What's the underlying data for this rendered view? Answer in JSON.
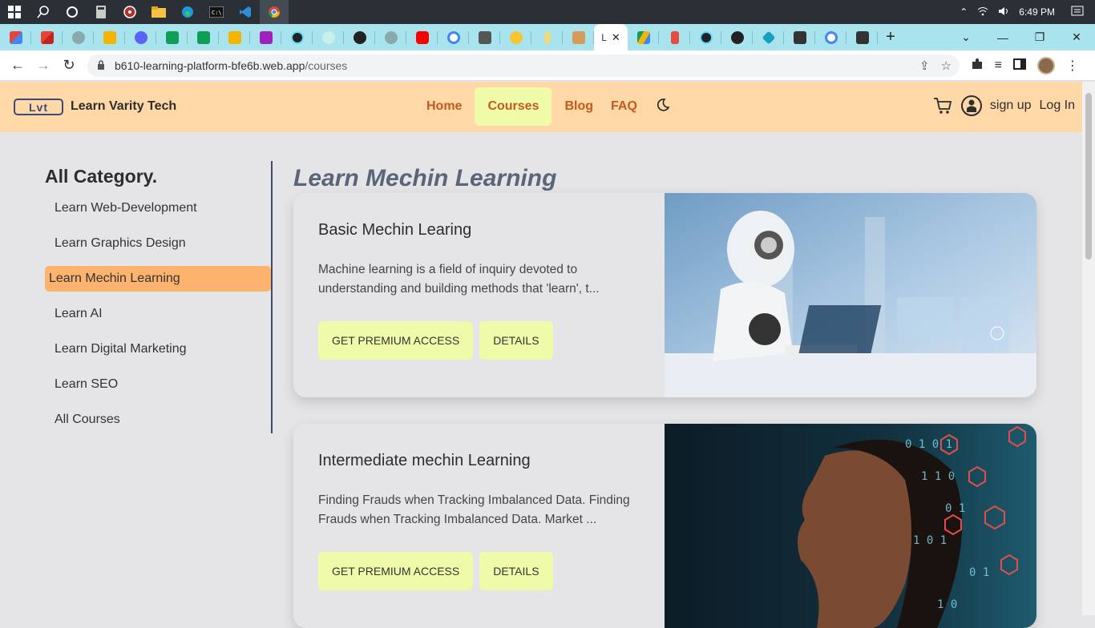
{
  "taskbar": {
    "time": "6:49 PM",
    "icons": [
      "windows-start",
      "search",
      "cortana",
      "calculator",
      "media",
      "file-explorer",
      "edge",
      "terminal",
      "vscode",
      "chrome"
    ]
  },
  "browser": {
    "url_host": "b610-learning-platform-bfe6b.web.app",
    "url_path": "/courses",
    "active_tab_label": "L",
    "tab_close": "✕",
    "new_tab": "+"
  },
  "site": {
    "logo_text": "Lvt",
    "name": "Learn Varity Tech",
    "nav": [
      {
        "label": "Home"
      },
      {
        "label": "Courses"
      },
      {
        "label": "Blog"
      },
      {
        "label": "FAQ"
      }
    ],
    "signup_label": "sign up",
    "login_label": "Log In"
  },
  "sidebar": {
    "title": "All Category.",
    "items": [
      {
        "label": "Learn Web-Development"
      },
      {
        "label": "Learn Graphics Design"
      },
      {
        "label": "Learn Mechin Learning"
      },
      {
        "label": "Learn AI"
      },
      {
        "label": "Learn Digital Marketing"
      },
      {
        "label": "Learn SEO"
      },
      {
        "label": "All Courses"
      }
    ]
  },
  "main": {
    "title": "Learn Mechin Learning",
    "courses": [
      {
        "title": "Basic Mechin Learing",
        "description": "Machine learning is a field of inquiry devoted to understanding and building methods that 'learn', t...",
        "premium_label": "GET PREMIUM ACCESS",
        "details_label": "DETAILS"
      },
      {
        "title": "Intermediate mechin Learning",
        "description": "Finding Frauds when Tracking Imbalanced Data. Finding Frauds when Tracking Imbalanced Data. Market ...",
        "premium_label": "GET PREMIUM ACCESS",
        "details_label": "DETAILS"
      }
    ]
  },
  "colors": {
    "navbar_bg": "#fed8a7",
    "nav_link": "#c45a1f",
    "active_nav_bg": "#f0fbaa",
    "sidebar_active": "#fcb36e",
    "page_bg": "#e5e5e7",
    "tabstrip_bg": "#a9e4ee"
  }
}
